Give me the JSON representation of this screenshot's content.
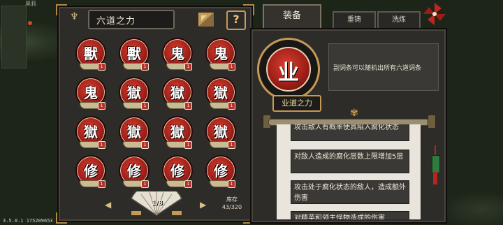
{
  "world": {
    "corner_label": "黑莉"
  },
  "version": "3.5.0.1 175209653",
  "left_panel": {
    "title": "六道之力",
    "help_label": "?",
    "tokens": [
      {
        "glyph": "獸",
        "badge": "1"
      },
      {
        "glyph": "獸",
        "badge": "1"
      },
      {
        "glyph": "鬼",
        "badge": "1"
      },
      {
        "glyph": "鬼",
        "badge": "1"
      },
      {
        "glyph": "鬼",
        "badge": "1"
      },
      {
        "glyph": "獄",
        "badge": "1"
      },
      {
        "glyph": "獄",
        "badge": "1"
      },
      {
        "glyph": "獄",
        "badge": "1"
      },
      {
        "glyph": "獄",
        "badge": "1"
      },
      {
        "glyph": "獄",
        "badge": "1"
      },
      {
        "glyph": "獄",
        "badge": "1"
      },
      {
        "glyph": "獄",
        "badge": "1"
      },
      {
        "glyph": "修",
        "badge": "1"
      },
      {
        "glyph": "修",
        "badge": "1"
      },
      {
        "glyph": "修",
        "badge": "1"
      },
      {
        "glyph": "修",
        "badge": "1"
      }
    ],
    "page": "1/8",
    "stock_label": "库存",
    "stock_value": "43/320"
  },
  "right_panel": {
    "tabs": [
      "装备",
      "重铸",
      "洗炼"
    ],
    "big_glyph": "业",
    "item_name": "业道之力",
    "description": "副词条可以随机出所有六道词条",
    "entries": [
      "攻击敌人有概率使其陷入腐化状态",
      "对敌人造成的腐化层数上限增加5层",
      "攻击处于腐化状态的敌人，造成额外伤害",
      "对精英和领主怪物造成的伤害"
    ]
  },
  "colors": {
    "panel_bg": "#2e2c29",
    "accent_gold": "#c49a55",
    "token_red": "#a2201a",
    "scroll_paper": "#e9e5dc"
  }
}
